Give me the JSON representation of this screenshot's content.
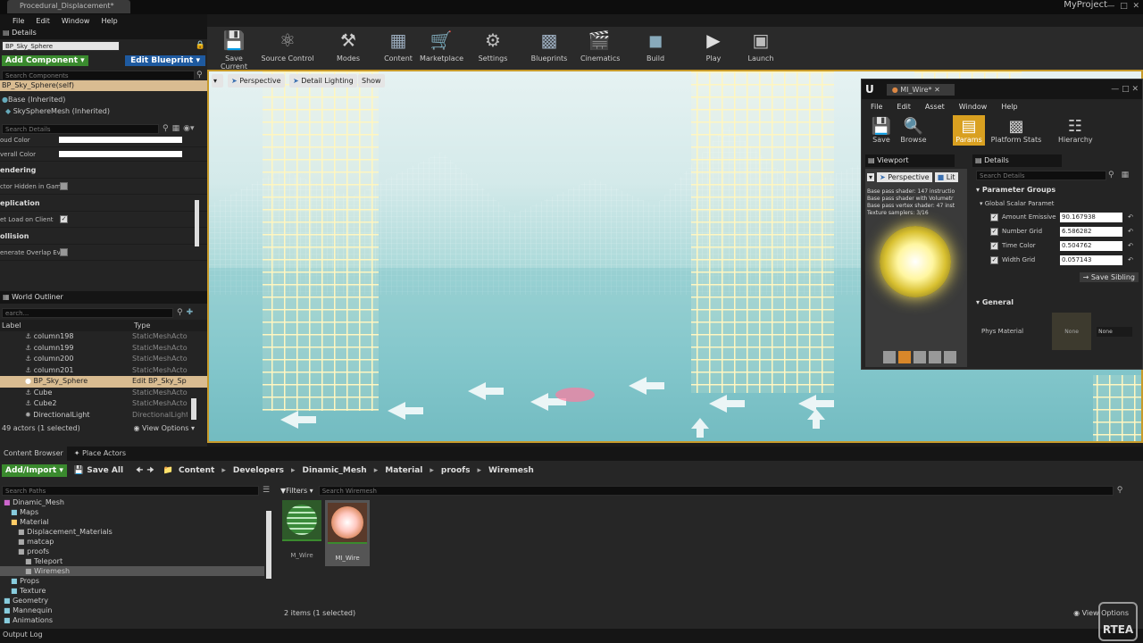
{
  "window": {
    "doc_tab": "Procedural_Displacement*",
    "project": "MyProject"
  },
  "menu": [
    "File",
    "Edit",
    "Window",
    "Help"
  ],
  "details": {
    "tab": "Details",
    "actor_name": "BP_Sky_Sphere",
    "add_component": "Add Component ▾",
    "edit_blueprint": "Edit Blueprint ▾",
    "search_components": "Search Components",
    "components": [
      "BP_Sky_Sphere(self)",
      "Base (Inherited)",
      "SkySphereMesh (Inherited)"
    ],
    "search_details": "Search Details",
    "props": {
      "cloud_color": "oud Color",
      "overall_color": "verall Color"
    },
    "categories": {
      "rendering": "endering",
      "replication": "eplication",
      "collision": "ollision"
    },
    "checks": {
      "hidden": "ctor Hidden in Gam",
      "net_load": "et Load on Client",
      "overlap": "enerate Overlap Ev"
    }
  },
  "outliner": {
    "tab": "World Outliner",
    "search": "earch...",
    "col_label": "Label",
    "col_type": "Type",
    "rows": [
      {
        "label": "column198",
        "type": "StaticMeshActor"
      },
      {
        "label": "column199",
        "type": "StaticMeshActor"
      },
      {
        "label": "column200",
        "type": "StaticMeshActor"
      },
      {
        "label": "column201",
        "type": "StaticMeshActor"
      },
      {
        "label": "BP_Sky_Sphere",
        "type": "Edit BP_Sky_Sp"
      },
      {
        "label": "Cube",
        "type": "StaticMeshActor"
      },
      {
        "label": "Cube2",
        "type": "StaticMeshActor"
      },
      {
        "label": "DirectionalLight",
        "type": "DirectionalLight"
      }
    ],
    "count": "49 actors (1 selected)",
    "view_options": "View Options ▾"
  },
  "toolbar": {
    "buttons": [
      "Save Current",
      "Source Control",
      "Modes",
      "Content",
      "Marketplace",
      "Settings",
      "Blueprints",
      "Cinematics",
      "Build",
      "Play",
      "Launch"
    ]
  },
  "viewport": {
    "perspective": "Perspective",
    "lighting": "Detail Lighting",
    "show": "Show"
  },
  "material_editor": {
    "tab": "MI_Wire*",
    "menu": [
      "File",
      "Edit",
      "Asset",
      "Window",
      "Help"
    ],
    "buttons": [
      "Save",
      "Browse",
      "Params",
      "Platform Stats",
      "Hierarchy"
    ],
    "viewport_tab": "Viewport",
    "details_tab": "Details",
    "perspective": "Perspective",
    "lit": "Lit",
    "stats": [
      "Base pass shader: 147 instructio",
      "Base pass shader with Volumetr",
      "Base pass vertex shader: 47 inst",
      "Texture samplers: 3/16"
    ],
    "search": "Search Details",
    "param_groups": "Parameter Groups",
    "global_scalar": "Global Scalar Paramet",
    "params": [
      {
        "name": "Amount Emissive",
        "value": "90.167938"
      },
      {
        "name": "Number Grid",
        "value": "6.586282"
      },
      {
        "name": "Time Color",
        "value": "0.504762"
      },
      {
        "name": "Width Grid",
        "value": "0.057143"
      }
    ],
    "save_sibling": "Save Sibling",
    "general": "General",
    "phys_material": "Phys Material",
    "none": "None",
    "none_dropdown": "None"
  },
  "content_browser": {
    "tabs": [
      "Content Browser",
      "Place Actors"
    ],
    "add_import": "Add/Import ▾",
    "save_all": "Save All",
    "breadcrumb": [
      "Content",
      "Developers",
      "Dinamic_Mesh",
      "Material",
      "proofs",
      "Wiremesh"
    ],
    "search_paths": "Search Paths",
    "filters": "Filters ▾",
    "search_assets": "Search Wiremesh",
    "tree": [
      "Dinamic_Mesh",
      "Maps",
      "Material",
      "Displacement_Materials",
      "matcap",
      "proofs",
      "Teleport",
      "Wiremesh",
      "Props",
      "Texture",
      "Geometry",
      "Mannequin",
      "Animations"
    ],
    "assets": [
      {
        "name": "M_Wire"
      },
      {
        "name": "MI_Wire"
      }
    ],
    "count": "2 items (1 selected)",
    "view_options": "View Options"
  },
  "output_log": "Output Log",
  "watermark": "RTEA"
}
